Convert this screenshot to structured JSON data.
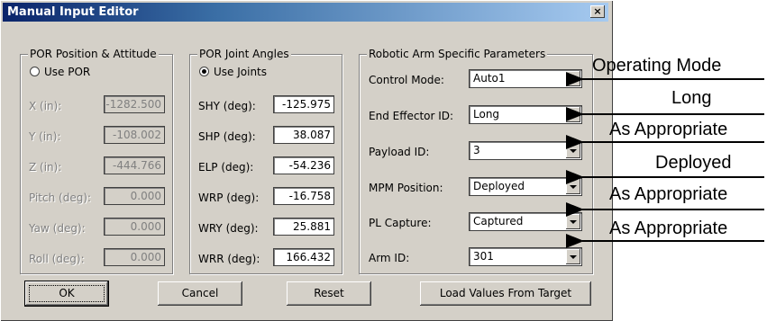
{
  "window": {
    "title": "Manual Input Editor",
    "close_glyph": "×"
  },
  "por_position": {
    "legend": "POR Position & Attitude",
    "radio_label": "Use POR",
    "radio_selected": false,
    "fields": [
      {
        "label": "X (in):",
        "value": "-1282.500"
      },
      {
        "label": "Y (in):",
        "value": "-108.002"
      },
      {
        "label": "Z (in):",
        "value": "-444.766"
      },
      {
        "label": "Pitch (deg):",
        "value": "0.000"
      },
      {
        "label": "Yaw (deg):",
        "value": "0.000"
      },
      {
        "label": "Roll (deg):",
        "value": "0.000"
      }
    ]
  },
  "joint_angles": {
    "legend": "POR Joint Angles",
    "radio_label": "Use Joints",
    "radio_selected": true,
    "fields": [
      {
        "label": "SHY (deg):",
        "value": "-125.975"
      },
      {
        "label": "SHP (deg):",
        "value": "38.087"
      },
      {
        "label": "ELP (deg):",
        "value": "-54.236"
      },
      {
        "label": "WRP (deg):",
        "value": "-16.758"
      },
      {
        "label": "WRY (deg):",
        "value": "25.881"
      },
      {
        "label": "WRR (deg):",
        "value": "166.432"
      }
    ]
  },
  "arm_params": {
    "legend": "Robotic Arm Specific Parameters",
    "fields": [
      {
        "label": "Control Mode:",
        "value": "Auto1"
      },
      {
        "label": "End Effector ID:",
        "value": "Long"
      },
      {
        "label": "Payload ID:",
        "value": "3"
      },
      {
        "label": "MPM Position:",
        "value": "Deployed"
      },
      {
        "label": "PL Capture:",
        "value": "Captured"
      },
      {
        "label": "Arm ID:",
        "value": "301"
      }
    ]
  },
  "buttons": {
    "ok": "OK",
    "cancel": "Cancel",
    "reset": "Reset",
    "load": "Load Values From Target"
  },
  "annotations": [
    "Operating Mode",
    "Long",
    "As Appropriate",
    "Deployed",
    "As Appropriate",
    "As Appropriate"
  ]
}
